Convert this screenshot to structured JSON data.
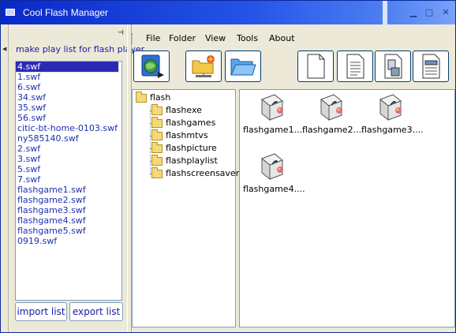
{
  "window": {
    "title": "Cool Flash Manager",
    "minimize": "▁",
    "maximize": "□",
    "close": "✕"
  },
  "left_panel": {
    "title": "make play list for flash player",
    "pin_glyph": "⊣",
    "files": [
      "4.swf",
      "1.swf",
      "6.swf",
      "34.swf",
      "35.swf",
      "56.swf",
      "citic-bt-home-0103.swf",
      "ny585140.swf",
      "2.swf",
      "3.swf",
      "5.swf",
      "7.swf",
      "flashgame1.swf",
      "flashgame2.swf",
      "flashgame3.swf",
      "flashgame4.swf",
      "flashgame5.swf",
      "0919.swf"
    ],
    "selected_index": 0,
    "import_label": "import list",
    "export_label": "export list"
  },
  "menu": {
    "items": [
      "File",
      "Folder",
      "View",
      "Tools",
      "About"
    ]
  },
  "toolbar": {
    "buttons": [
      "globe-play-icon",
      "network-folder-icon",
      "open-folder-icon",
      "blank-document-icon",
      "text-document-icon",
      "device-document-icon",
      "list-document-icon"
    ]
  },
  "tree": {
    "root": "flash",
    "children": [
      "flashexe",
      "flashgames",
      "flashmtvs",
      "flashpicture",
      "flashplaylist",
      "flashscreensaver"
    ],
    "selected": "flashgames"
  },
  "files_view": {
    "items": [
      "flashgame1....",
      "flashgame2....",
      "flashgame3....",
      "flashgame4...."
    ]
  },
  "colors": {
    "title_bar": "#0a28c8",
    "link_blue": "#1e30b0",
    "selection": "#2a2ab5",
    "border": "#7f9db9"
  }
}
